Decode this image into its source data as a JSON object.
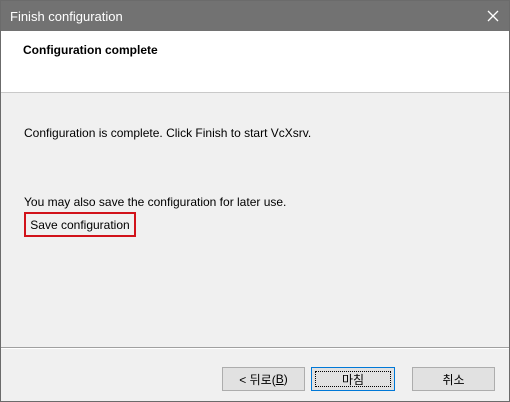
{
  "window": {
    "title": "Finish configuration",
    "close_icon": "close-icon"
  },
  "header": {
    "heading": "Configuration complete"
  },
  "main": {
    "message": "Configuration is complete. Click Finish to start VcXsrv.",
    "save_hint": "You may also save the configuration for later use.",
    "save_button": "Save configuration"
  },
  "footer": {
    "back_prefix": "< 뒤로(",
    "back_accel": "B",
    "back_suffix": ")",
    "finish_label": "마침",
    "cancel_label": "취소"
  },
  "colors": {
    "titlebar": "#727272",
    "highlight_border": "#d1121a",
    "default_button_border": "#0078d7"
  }
}
